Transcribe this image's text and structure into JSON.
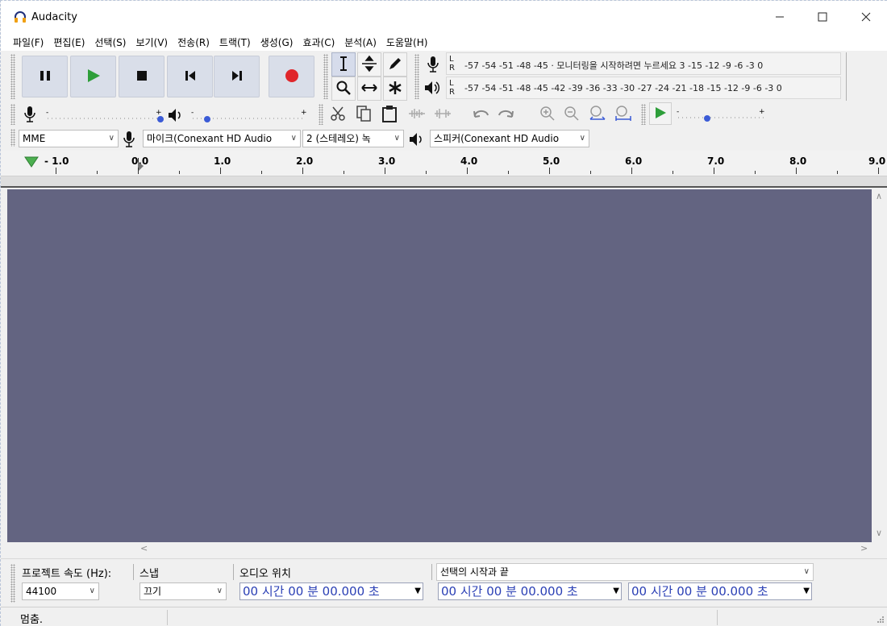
{
  "window": {
    "title": "Audacity"
  },
  "menu": [
    "파일(F)",
    "편집(E)",
    "선택(S)",
    "보기(V)",
    "전송(R)",
    "트랙(T)",
    "생성(G)",
    "효과(C)",
    "분석(A)",
    "도움말(H)"
  ],
  "meters": {
    "record_scale": "-57 -54 -51 -48 -45 · 모니터링을 시작하려면 누르세요 3 -15 -12 -9 -6 -3 0",
    "play_scale": "-57 -54 -51 -48 -45 -42 -39 -36 -33 -30 -27 -24 -21 -18 -15 -12 -9 -6 -3 0",
    "lr": "L\nR"
  },
  "devices": {
    "host": "MME",
    "input": "마이크(Conexant HD Audio",
    "channels": "2 (스테레오) 녹",
    "output": "스피커(Conexant HD Audio"
  },
  "ruler": {
    "ticks": [
      "- 1.0",
      "0.0",
      "1.0",
      "2.0",
      "3.0",
      "4.0",
      "5.0",
      "6.0",
      "7.0",
      "8.0",
      "9.0"
    ]
  },
  "selection_toolbar": {
    "rate_label": "프로젝트 속도 (Hz):",
    "rate_value": "44100",
    "snap_label": "스냅",
    "snap_value": "끄기",
    "position_label": "오디오 위치",
    "selection_label": "선택의 시작과 끝",
    "position_time": "00 시간 00 분 00.000 초",
    "start_time": "00 시간 00 분 00.000 초",
    "end_time": "00 시간 00 분 00.000 초"
  },
  "status": {
    "text": "멈춤."
  },
  "colors": {
    "accent_play": "#2e9e3a",
    "record": "#e0262b",
    "track_bg": "#636481",
    "time_text": "#2a3fb5"
  }
}
